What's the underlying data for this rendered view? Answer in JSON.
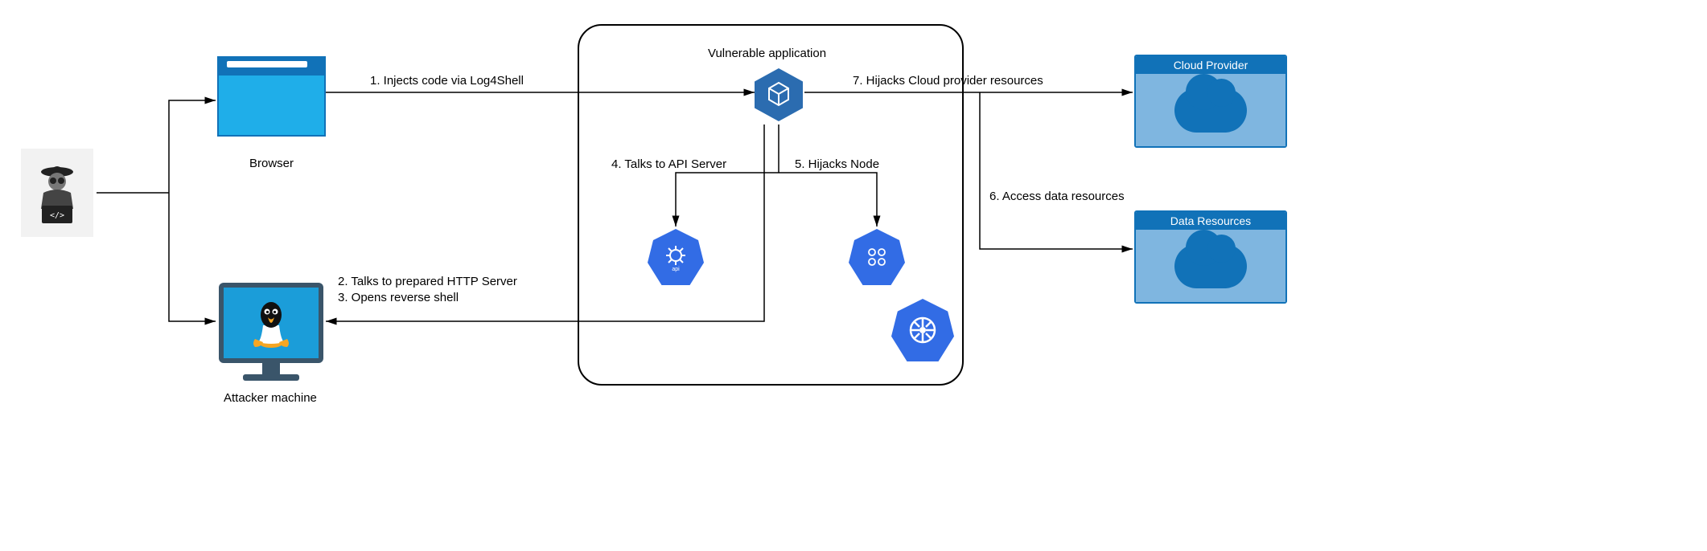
{
  "nodes": {
    "hacker": "hacker-icon",
    "browser": "Browser",
    "attacker_machine": "Attacker machine",
    "vulnerable_app": "Vulnerable application",
    "cloud_provider": "Cloud Provider",
    "data_resources": "Data Resources"
  },
  "edges": {
    "e1": "1. Injects code via Log4Shell",
    "e2": "2. Talks to prepared HTTP Server",
    "e3": "3. Opens reverse shell",
    "e4": "4. Talks to API Server",
    "e5": "5. Hijacks Node",
    "e6": "6. Access data resources",
    "e7": "7. Hijacks Cloud provider resources"
  }
}
